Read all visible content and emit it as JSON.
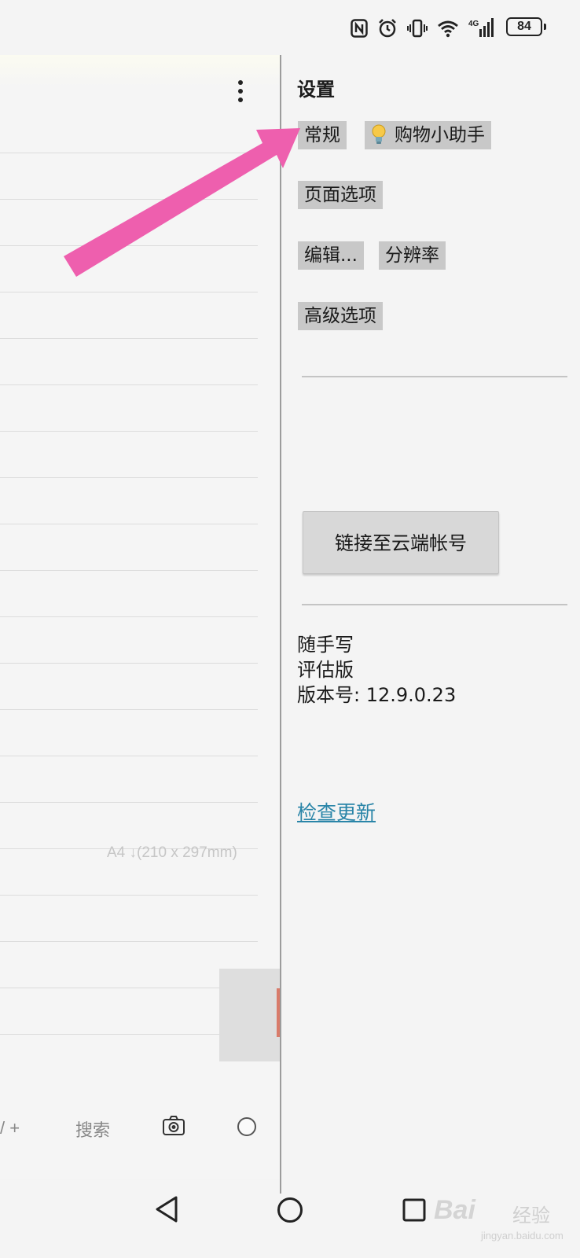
{
  "status_bar": {
    "battery": "84",
    "network": "4G",
    "icons": [
      "nfc-icon",
      "alarm-icon",
      "vibrate-icon",
      "wifi-icon",
      "signal-icon",
      "battery-icon"
    ]
  },
  "editor": {
    "page_size": "A4 ↓(210 x 297mm)",
    "toolbar": {
      "zoom": "/ +",
      "search": "搜索"
    }
  },
  "settings": {
    "title": "设置",
    "tabs": [
      {
        "label": "常规"
      },
      {
        "label": "购物小助手",
        "icon": "lightbulb-icon"
      },
      {
        "label": "页面选项"
      },
      {
        "label": "编辑..."
      },
      {
        "label": "分辨率"
      },
      {
        "label": "高级选项"
      }
    ],
    "cloud_button": "链接至云端帐号",
    "about": {
      "app_name": "随手写",
      "edition": "评估版",
      "version": "版本号: 12.9.0.23"
    },
    "update_link": "检查更新"
  },
  "annotation": {
    "arrow_color": "#ee5fae"
  },
  "watermark": {
    "brand": "Bai",
    "sub": "经验",
    "url": "jingyan.baidu.com"
  },
  "colors": {
    "tab_bg": "#c8c8c8",
    "link": "#2a85a8",
    "background": "#f4f4f4"
  }
}
